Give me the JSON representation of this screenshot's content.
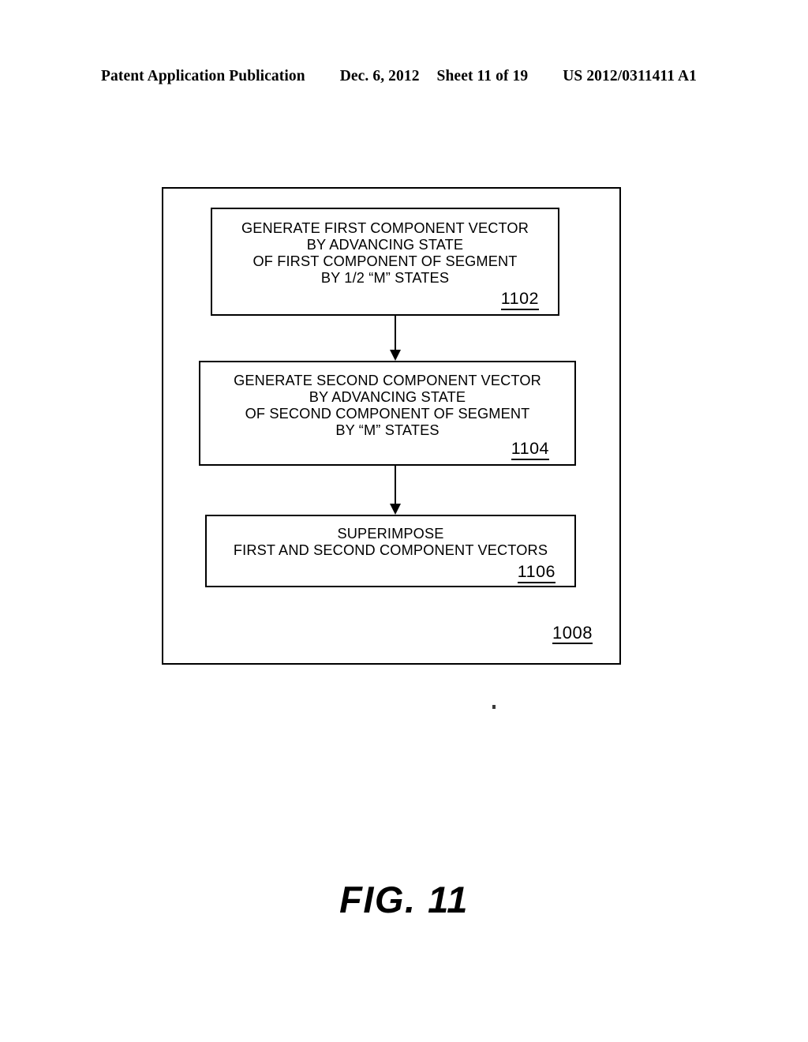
{
  "header": {
    "publication": "Patent Application Publication",
    "date": "Dec. 6, 2012",
    "sheet": "Sheet 11 of 19",
    "patent_number": "US 2012/0311411 A1"
  },
  "figure": {
    "caption": "FIG. 11",
    "container_ref": "1008",
    "steps": [
      {
        "ref": "1102",
        "lines": [
          "GENERATE FIRST COMPONENT VECTOR",
          "BY ADVANCING STATE",
          "OF FIRST COMPONENT OF SEGMENT",
          "BY 1/2 “M” STATES"
        ]
      },
      {
        "ref": "1104",
        "lines": [
          "GENERATE SECOND COMPONENT VECTOR",
          "BY ADVANCING STATE",
          "OF SECOND COMPONENT OF SEGMENT",
          "BY “M” STATES"
        ]
      },
      {
        "ref": "1106",
        "lines": [
          "SUPERIMPOSE",
          "FIRST AND SECOND COMPONENT VECTORS"
        ]
      }
    ]
  },
  "colors": {
    "ink": "#000000",
    "page": "#ffffff"
  }
}
